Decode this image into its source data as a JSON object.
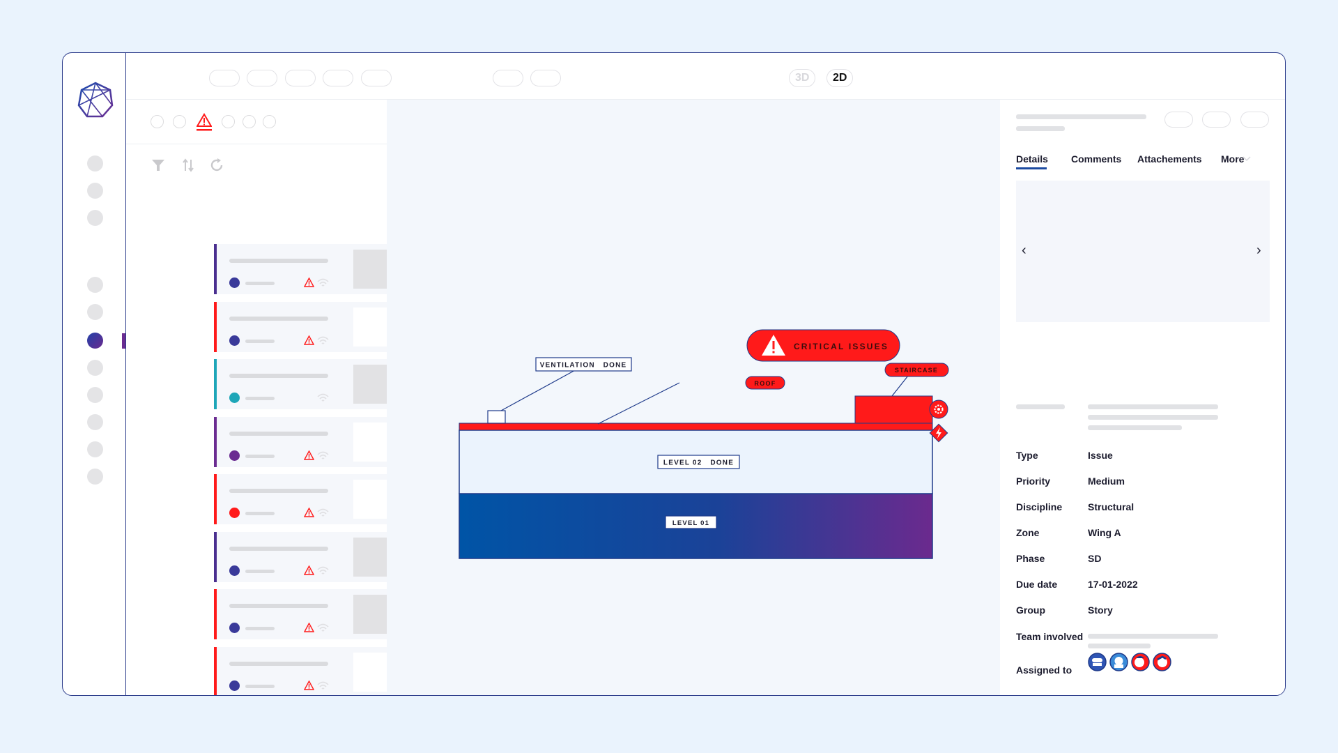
{
  "topbar": {
    "view_tabs": [
      {
        "label": "3D",
        "active": false
      },
      {
        "label": "2D",
        "active": true
      }
    ]
  },
  "list": {
    "cards": [
      {
        "accent": "#4a2f8f",
        "dot": "#3a3a9a",
        "warning": true,
        "thumbnail": true
      },
      {
        "accent": "#ff1a1a",
        "dot": "#3a3a9a",
        "warning": true,
        "thumbnail": false
      },
      {
        "accent": "#1ea6b8",
        "dot": "#1ea6b8",
        "warning": false,
        "thumbnail": true
      },
      {
        "accent": "#6b2c91",
        "dot": "#6b2c91",
        "warning": true,
        "thumbnail": false
      },
      {
        "accent": "#ff1a1a",
        "dot": "#ff1a1a",
        "warning": true,
        "thumbnail": false
      },
      {
        "accent": "#4a2f8f",
        "dot": "#3a3a9a",
        "warning": true,
        "thumbnail": true
      },
      {
        "accent": "#ff1a1a",
        "dot": "#3a3a9a",
        "warning": true,
        "thumbnail": true
      },
      {
        "accent": "#ff1a1a",
        "dot": "#3a3a9a",
        "warning": true,
        "thumbnail": false
      }
    ]
  },
  "canvas": {
    "critical_label": "CRITICAL ISSUES",
    "ventilation_label": "VENTILATION   DONE",
    "roof_label": "ROOF",
    "staircase_label": "STAIRCASE",
    "level02_label": "LEVEL 02   DONE",
    "level01_label": "LEVEL 01"
  },
  "details": {
    "tabs": [
      "Details",
      "Comments",
      "Attachements",
      "More"
    ],
    "fields": [
      {
        "label": "Type",
        "value": "Issue"
      },
      {
        "label": "Priority",
        "value": "Medium"
      },
      {
        "label": "Discipline",
        "value": "Structural"
      },
      {
        "label": "Zone",
        "value": "Wing A"
      },
      {
        "label": "Phase",
        "value": "SD"
      },
      {
        "label": "Due date",
        "value": "17-01-2022"
      },
      {
        "label": "Group",
        "value": "Story"
      }
    ],
    "team_label": "Team involved",
    "assigned_label": "Assigned to",
    "gallery_prev": "‹",
    "gallery_next": "›"
  },
  "colors": {
    "accent_red": "#ff1a1a",
    "brand_blue": "#0052a6",
    "brand_purple": "#6b2c91",
    "outline": "#2a3a8a"
  }
}
